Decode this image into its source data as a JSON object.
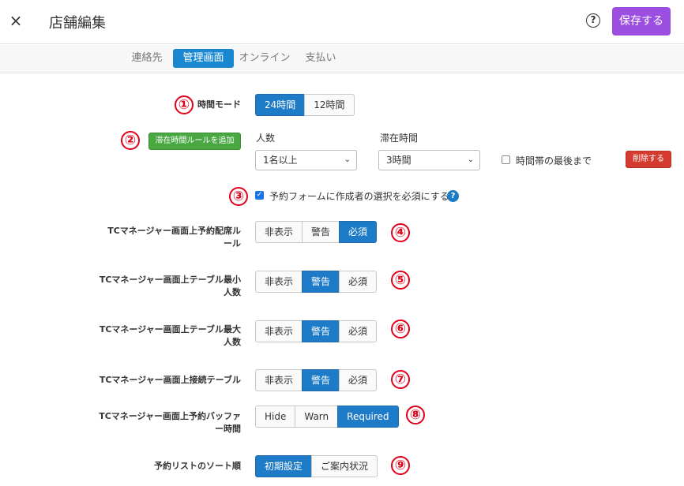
{
  "header": {
    "close_icon": "×",
    "title": "店舗編集",
    "help_icon": "?",
    "save_label": "保存する"
  },
  "tabs": [
    {
      "label": "連絡先",
      "active": false
    },
    {
      "label": "管理画面",
      "active": true
    },
    {
      "label": "オンライン",
      "active": false
    },
    {
      "label": "支払い",
      "active": false
    }
  ],
  "markers": [
    "①",
    "②",
    "③",
    "④",
    "⑤",
    "⑥",
    "⑦",
    "⑧",
    "⑨"
  ],
  "time_mode": {
    "label": "時間モード",
    "options": [
      "24時間",
      "12時間"
    ],
    "selected": "24時間"
  },
  "stay_rule": {
    "add_button": "滞在時間ルールを追加",
    "people_label": "人数",
    "people_value": "1名以上",
    "stay_label": "滞在時間",
    "stay_value": "3時間",
    "until_end_label": "時間帯の最後まで",
    "until_end_checked": false,
    "delete_button": "削除する"
  },
  "require_creator": {
    "label": "予約フォームに作成者の選択を必須にする",
    "checked": true,
    "help_icon": "?"
  },
  "settings": [
    {
      "label_line1": "TCマネージャー画面上予約配席ル",
      "label_line2": "ール",
      "options": [
        "非表示",
        "警告",
        "必須"
      ],
      "selected": "必須"
    },
    {
      "label_line1": "TCマネージャー画面上テーブル最小",
      "label_line2": "人数",
      "options": [
        "非表示",
        "警告",
        "必須"
      ],
      "selected": "警告"
    },
    {
      "label_line1": "TCマネージャー画面上テーブル最大",
      "label_line2": "人数",
      "options": [
        "非表示",
        "警告",
        "必須"
      ],
      "selected": "警告"
    },
    {
      "label_line1": "TCマネージャー画面上接続テーブル",
      "label_line2": "",
      "options": [
        "非表示",
        "警告",
        "必須"
      ],
      "selected": "警告"
    },
    {
      "label_line1": "TCマネージャー画面上予約バッファ",
      "label_line2": "ー時間",
      "options": [
        "Hide",
        "Warn",
        "Required"
      ],
      "selected": "Required"
    }
  ],
  "sort_order": {
    "label": "予約リストのソート順",
    "options": [
      "初期設定",
      "ご案内状況"
    ],
    "selected": "初期設定"
  },
  "colors": {
    "accent": "#9b4ee0",
    "active_blue": "#1e7bc7",
    "marker_red": "#e0001a",
    "green": "#4aa843",
    "danger": "#d53b2f"
  }
}
